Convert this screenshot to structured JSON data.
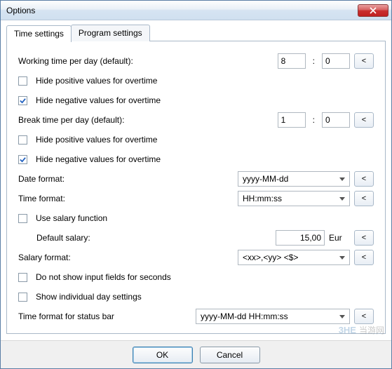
{
  "window": {
    "title": "Options"
  },
  "tabs": {
    "time": "Time settings",
    "program": "Program settings"
  },
  "worktime": {
    "label": "Working time per day (default):",
    "hours": "8",
    "minutes": "0",
    "hide_pos_label": "Hide positive values for overtime",
    "hide_pos_checked": false,
    "hide_neg_label": "Hide negative values for overtime",
    "hide_neg_checked": true
  },
  "breaktime": {
    "label": "Break time per day (default):",
    "hours": "1",
    "minutes": "0",
    "hide_pos_label": "Hide positive values for overtime",
    "hide_pos_checked": false,
    "hide_neg_label": "Hide negative values for overtime",
    "hide_neg_checked": true
  },
  "datefmt": {
    "label": "Date format:",
    "value": "yyyy-MM-dd"
  },
  "timefmt": {
    "label": "Time format:",
    "value": "HH:mm:ss"
  },
  "salary": {
    "use_label": "Use salary function",
    "use_checked": false,
    "default_label": "Default salary:",
    "value": "15,00",
    "currency": "Eur",
    "fmt_label": "Salary format:",
    "fmt_value": "<xx>,<yy> <$>"
  },
  "misc": {
    "hide_seconds_label": "Do not show input fields for seconds",
    "hide_seconds_checked": false,
    "show_individual_label": "Show individual day settings",
    "show_individual_checked": false
  },
  "statusfmt": {
    "label": "Time format for status bar",
    "value": "yyyy-MM-dd HH:mm:ss"
  },
  "buttons": {
    "ok": "OK",
    "cancel": "Cancel",
    "reset": "<"
  },
  "watermark": {
    "brand": "3HE",
    "text": "当游网"
  }
}
